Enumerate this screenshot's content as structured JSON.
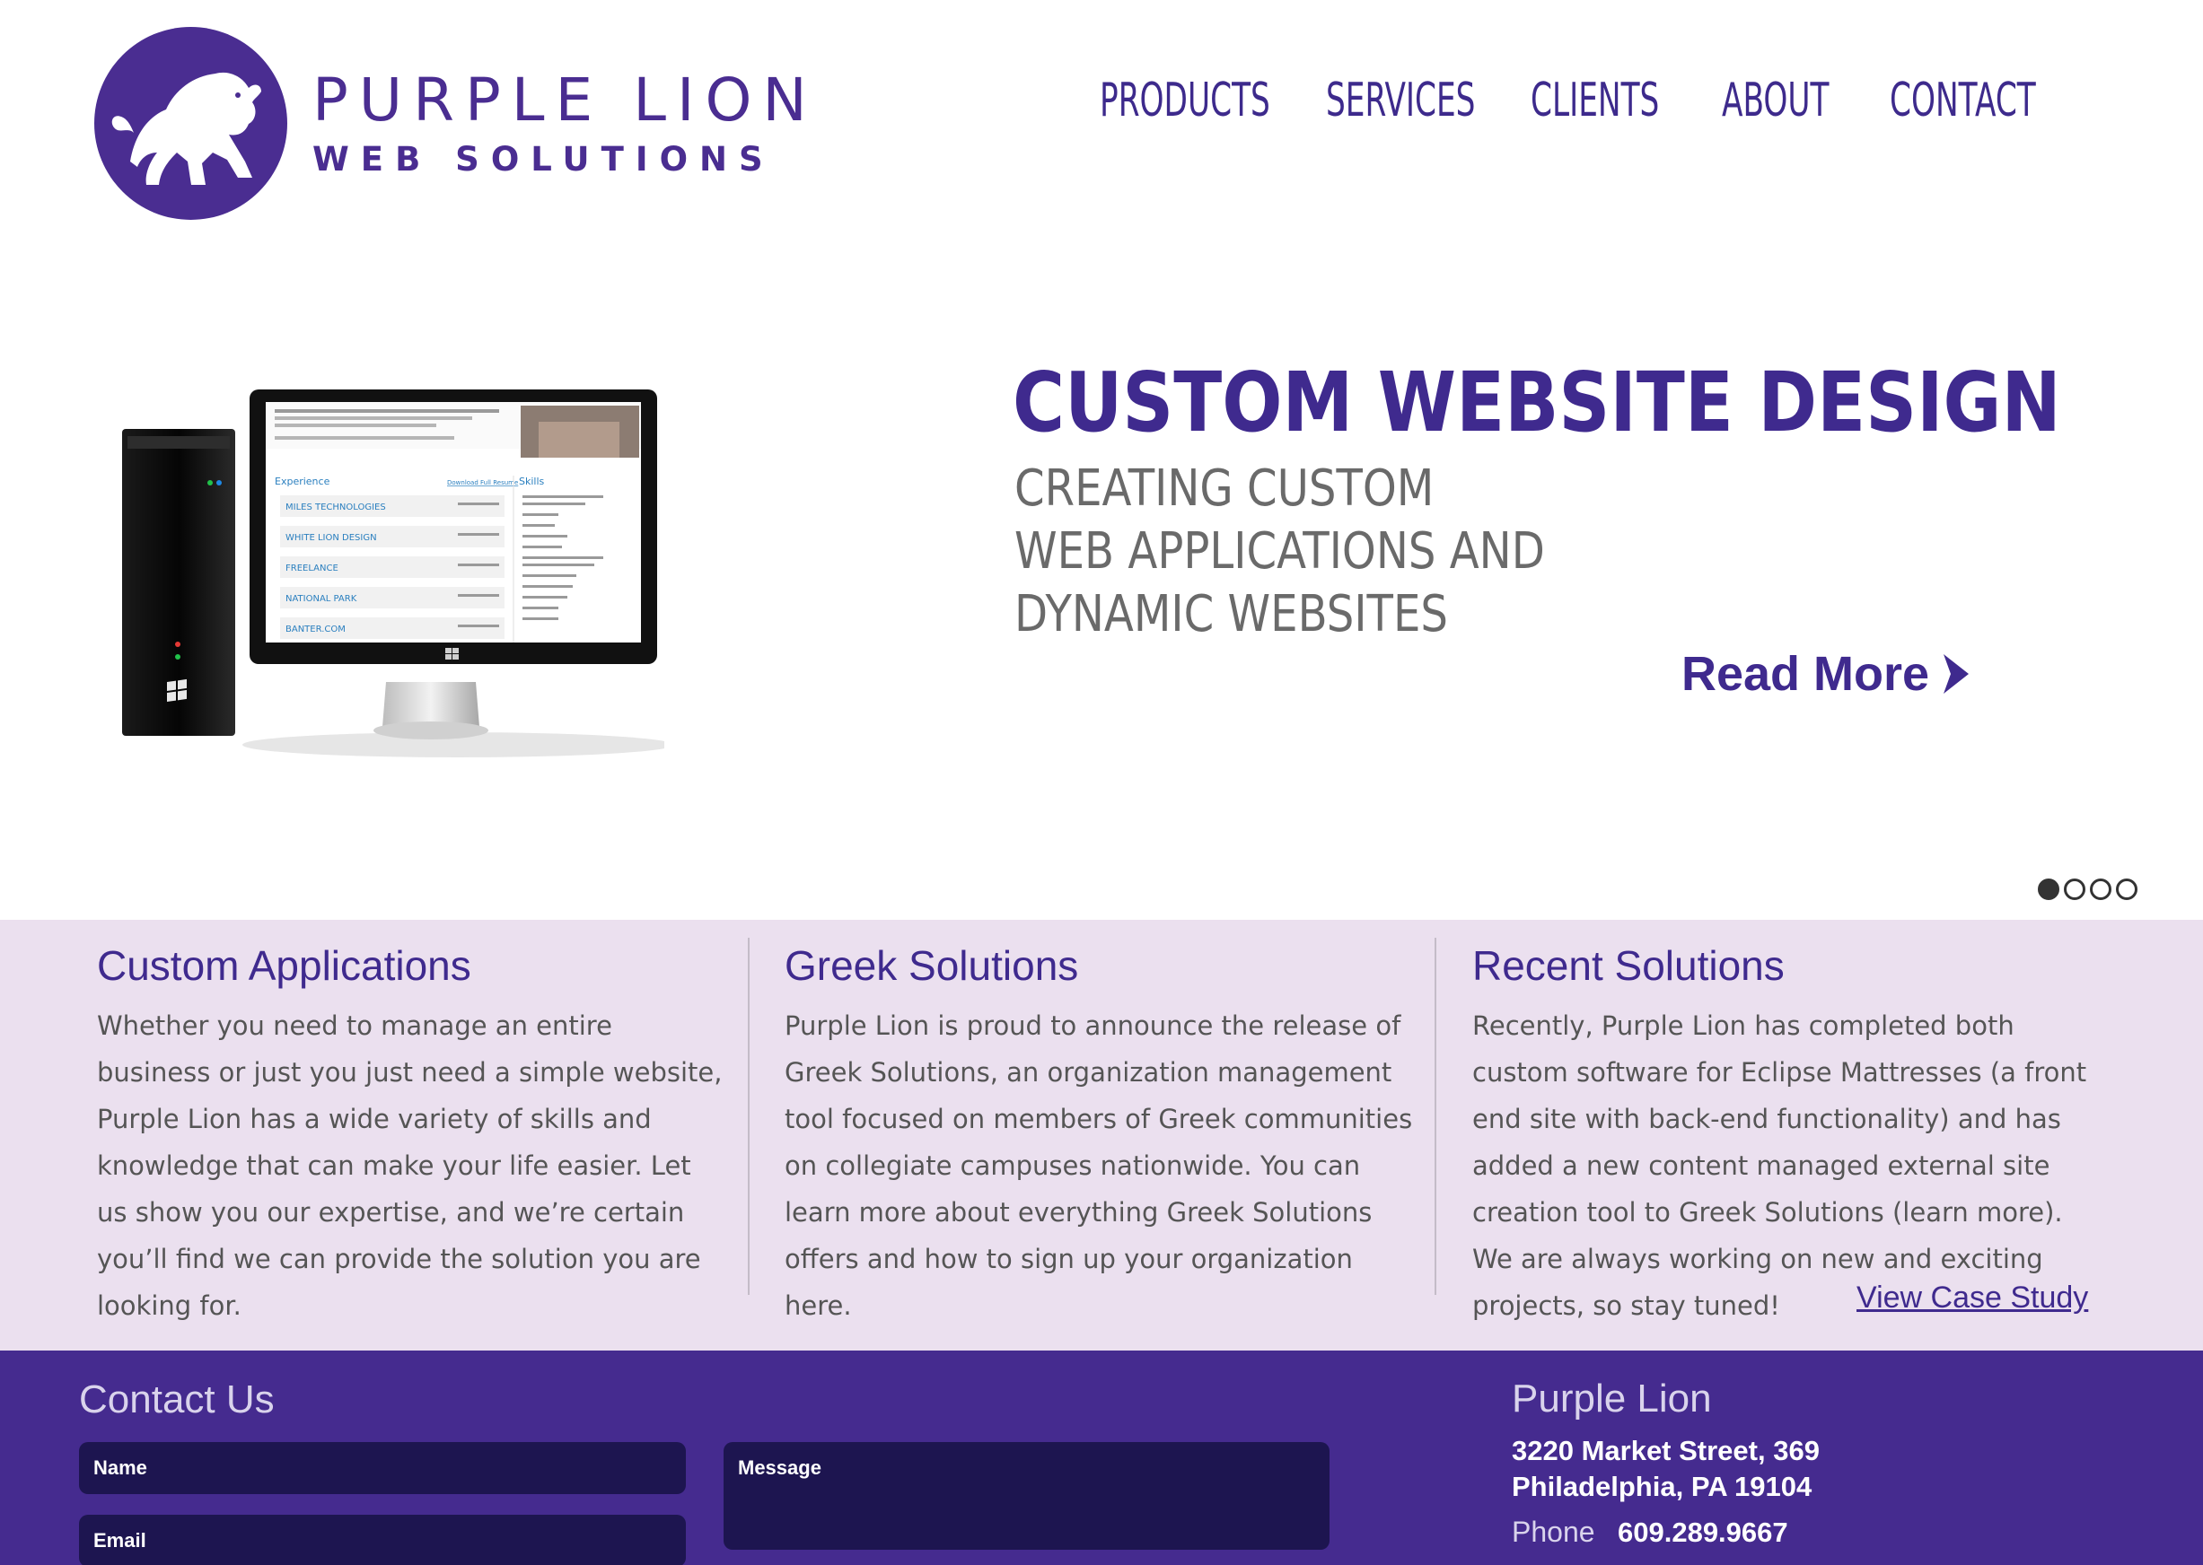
{
  "brand": {
    "name_line1": "PURPLE LION",
    "name_line2": "WEB SOLUTIONS",
    "accent_color": "#4a2d91"
  },
  "nav": {
    "items": [
      {
        "label": "PRODUCTS"
      },
      {
        "label": "SERVICES"
      },
      {
        "label": "CLIENTS"
      },
      {
        "label": "ABOUT"
      },
      {
        "label": "CONTACT"
      }
    ]
  },
  "hero": {
    "title": "CUSTOM WEBSITE DESIGN",
    "subtitle_lines": [
      "CREATING CUSTOM",
      "WEB APPLICATIONS AND",
      "DYNAMIC WEBSITES"
    ],
    "read_more": "Read More",
    "image_icon": "desktop-computer-with-monitor",
    "slide_count": 4,
    "active_slide": 1,
    "screen": {
      "section_experience": "Experience",
      "section_skills": "Skills",
      "download_link": "Download Full Resume",
      "jobs": [
        "MILES TECHNOLOGIES",
        "WHITE LION DESIGN",
        "FREELANCE",
        "NATIONAL PARK",
        "BANTER.COM"
      ]
    }
  },
  "info": {
    "columns": [
      {
        "title": "Custom Applications",
        "body": "Whether you need to manage an entire business or just you just need a simple website, Purple Lion has a wide variety of skills and knowledge that can make your life easier. Let us show you our expertise, and we’re certain you’ll find we can provide the solution you are looking for."
      },
      {
        "title": "Greek Solutions",
        "body": "Purple Lion is proud to announce the release of Greek Solutions, an organization management tool focused on members of Greek communities on collegiate campuses nationwide. You can learn more about everything Greek Solutions offers and how to sign up your organization here."
      },
      {
        "title": "Recent Solutions",
        "body": "Recently, Purple Lion has completed both custom software for Eclipse Mattresses (a front end site with back-end functionality) and has added a new content managed external site creation tool to Greek Solutions (learn more). We are always working on new and exciting projects, so stay tuned!"
      }
    ],
    "case_study_link": "View Case Study",
    "background_color": "#ebe0ef"
  },
  "footer": {
    "contact_title": "Contact Us",
    "form": {
      "name_placeholder": "Name",
      "email_placeholder": "Email",
      "message_placeholder": "Message"
    },
    "company_name": "Purple Lion",
    "address_line1": "3220 Market Street, 369",
    "address_line2": "Philadelphia, PA 19104",
    "phone_label": "Phone",
    "phone_value": "609.289.9667",
    "background_color": "#452b8f"
  }
}
